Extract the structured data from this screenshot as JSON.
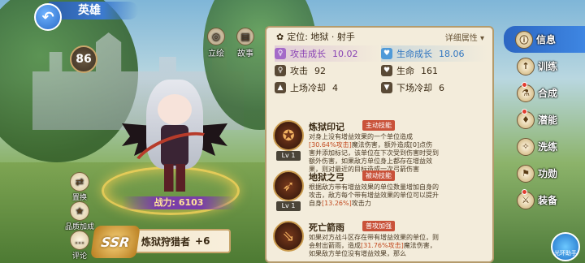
{
  "header": {
    "title": "英雄"
  },
  "hero": {
    "level": "86",
    "power_label": "战力:",
    "power_value": "6103",
    "rarity": "SSR",
    "name": "炼狱狩猎者",
    "plus": "+6"
  },
  "top_icons": [
    {
      "label": "立绘",
      "icon": "image-icon"
    },
    {
      "label": "故事",
      "icon": "book-icon"
    }
  ],
  "left_actions": [
    {
      "label": "置换",
      "icon": "swap-icon"
    },
    {
      "label": "品质加成",
      "icon": "quality-icon"
    },
    {
      "label": "评论",
      "icon": "comment-icon"
    }
  ],
  "panel": {
    "position_label": "定位: 地狱 · 射手",
    "detail_label": "详细属性",
    "stats": [
      [
        {
          "label": "攻击成长",
          "value": "10.02",
          "icon": "attack-growth-icon",
          "style": "purple"
        },
        {
          "label": "生命成长",
          "value": "18.06",
          "icon": "hp-growth-icon",
          "style": "blue"
        }
      ],
      [
        {
          "label": "攻击",
          "value": "92",
          "icon": "attack-icon"
        },
        {
          "label": "生命",
          "value": "161",
          "icon": "heart-icon"
        }
      ],
      [
        {
          "label": "上场冷却",
          "value": "4",
          "icon": "enter-cooldown-icon"
        },
        {
          "label": "下场冷却",
          "value": "6",
          "icon": "exit-cooldown-icon"
        }
      ]
    ],
    "skills": [
      {
        "name": "炼狱印记",
        "tag": "主动技能",
        "level": "Lv 1",
        "desc_pre": "对身上没有增益效果的一个单位造成",
        "desc_hi": "[30.64%攻击]",
        "desc_post": "魔法伤害，额外造成[0]点伤害并添加标记，该单位在下次受到伤害时受到额外伤害，如果敌方单位身上都存在增益效果，则对最近的目标造成一次弓箭伤害"
      },
      {
        "name": "地狱之弓",
        "tag": "被动技能",
        "level": "Lv 1",
        "desc_pre": "根据敌方带有增益效果的单位数量增加自身的攻击，敌方每个带有增益效果的单位可以提升自身",
        "desc_hi": "[13.26%]",
        "desc_post": "攻击力"
      },
      {
        "name": "死亡箭雨",
        "tag": "普攻加强",
        "level": "",
        "desc_pre": "如果对方战斗区存在带有增益效果的单位，则会射出箭雨，造成",
        "desc_hi": "[31.76%攻击]",
        "desc_post": "魔法伤害，如果敌方单位没有增益效果，那么"
      }
    ]
  },
  "menu": [
    {
      "label": "信息",
      "icon": "info-icon",
      "active": true,
      "badge": false
    },
    {
      "label": "训练",
      "icon": "training-icon",
      "active": false,
      "badge": false
    },
    {
      "label": "合成",
      "icon": "synthesis-icon",
      "active": false,
      "badge": true
    },
    {
      "label": "潜能",
      "icon": "potential-icon",
      "active": false,
      "badge": true
    },
    {
      "label": "洗练",
      "icon": "refine-icon",
      "active": false,
      "badge": false
    },
    {
      "label": "功勋",
      "icon": "merit-icon",
      "active": false,
      "badge": false
    },
    {
      "label": "装备",
      "icon": "equipment-icon",
      "active": false,
      "badge": true
    }
  ],
  "light_button": {
    "label": "光环助手"
  }
}
